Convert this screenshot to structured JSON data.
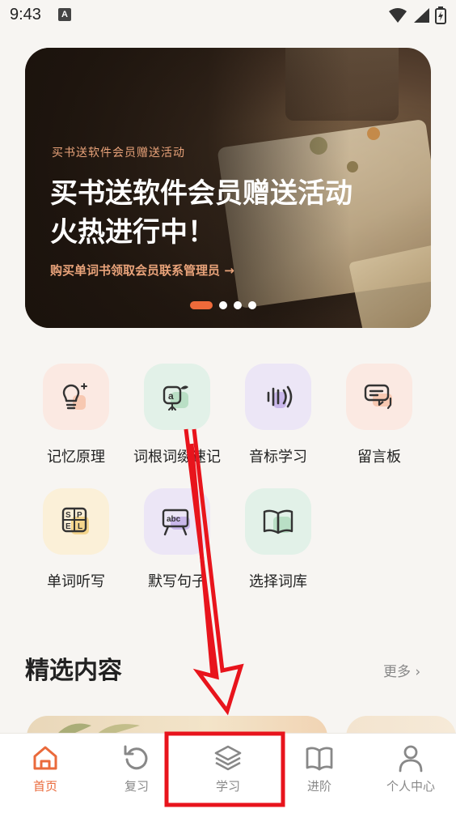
{
  "status_bar": {
    "time": "9:43",
    "notification_letter": "A"
  },
  "banner": {
    "kicker": "买书送软件会员赠送活动",
    "title_line1": "买书送软件会员赠送活动",
    "title_line2": "火热进行中！",
    "link": "购买单词书领取会员联系管理员 →",
    "slides_total": 4,
    "active_slide": 1
  },
  "grid": {
    "items": [
      {
        "label": "记忆原理",
        "icon": "lightbulb-icon"
      },
      {
        "label": "词根词缀速记",
        "icon": "sprout-a-icon"
      },
      {
        "label": "音标学习",
        "icon": "sound-wave-icon"
      },
      {
        "label": "留言板",
        "icon": "chat-bubbles-icon"
      },
      {
        "label": "单词听写",
        "icon": "spell-grid-icon"
      },
      {
        "label": "默写句子",
        "icon": "abc-board-icon"
      },
      {
        "label": "选择词库",
        "icon": "open-book-icon"
      }
    ]
  },
  "featured": {
    "title": "精选内容",
    "more": "更多 ›"
  },
  "tabs": [
    {
      "label": "首页",
      "icon": "home-icon",
      "active": true
    },
    {
      "label": "复习",
      "icon": "refresh-icon",
      "active": false
    },
    {
      "label": "学习",
      "icon": "layers-icon",
      "active": false
    },
    {
      "label": "进阶",
      "icon": "book-icon",
      "active": false
    },
    {
      "label": "个人中心",
      "icon": "user-icon",
      "active": false
    }
  ],
  "colors": {
    "accent": "#ea6a3b",
    "background": "#f7f5f2",
    "annotation": "#e8141c"
  }
}
